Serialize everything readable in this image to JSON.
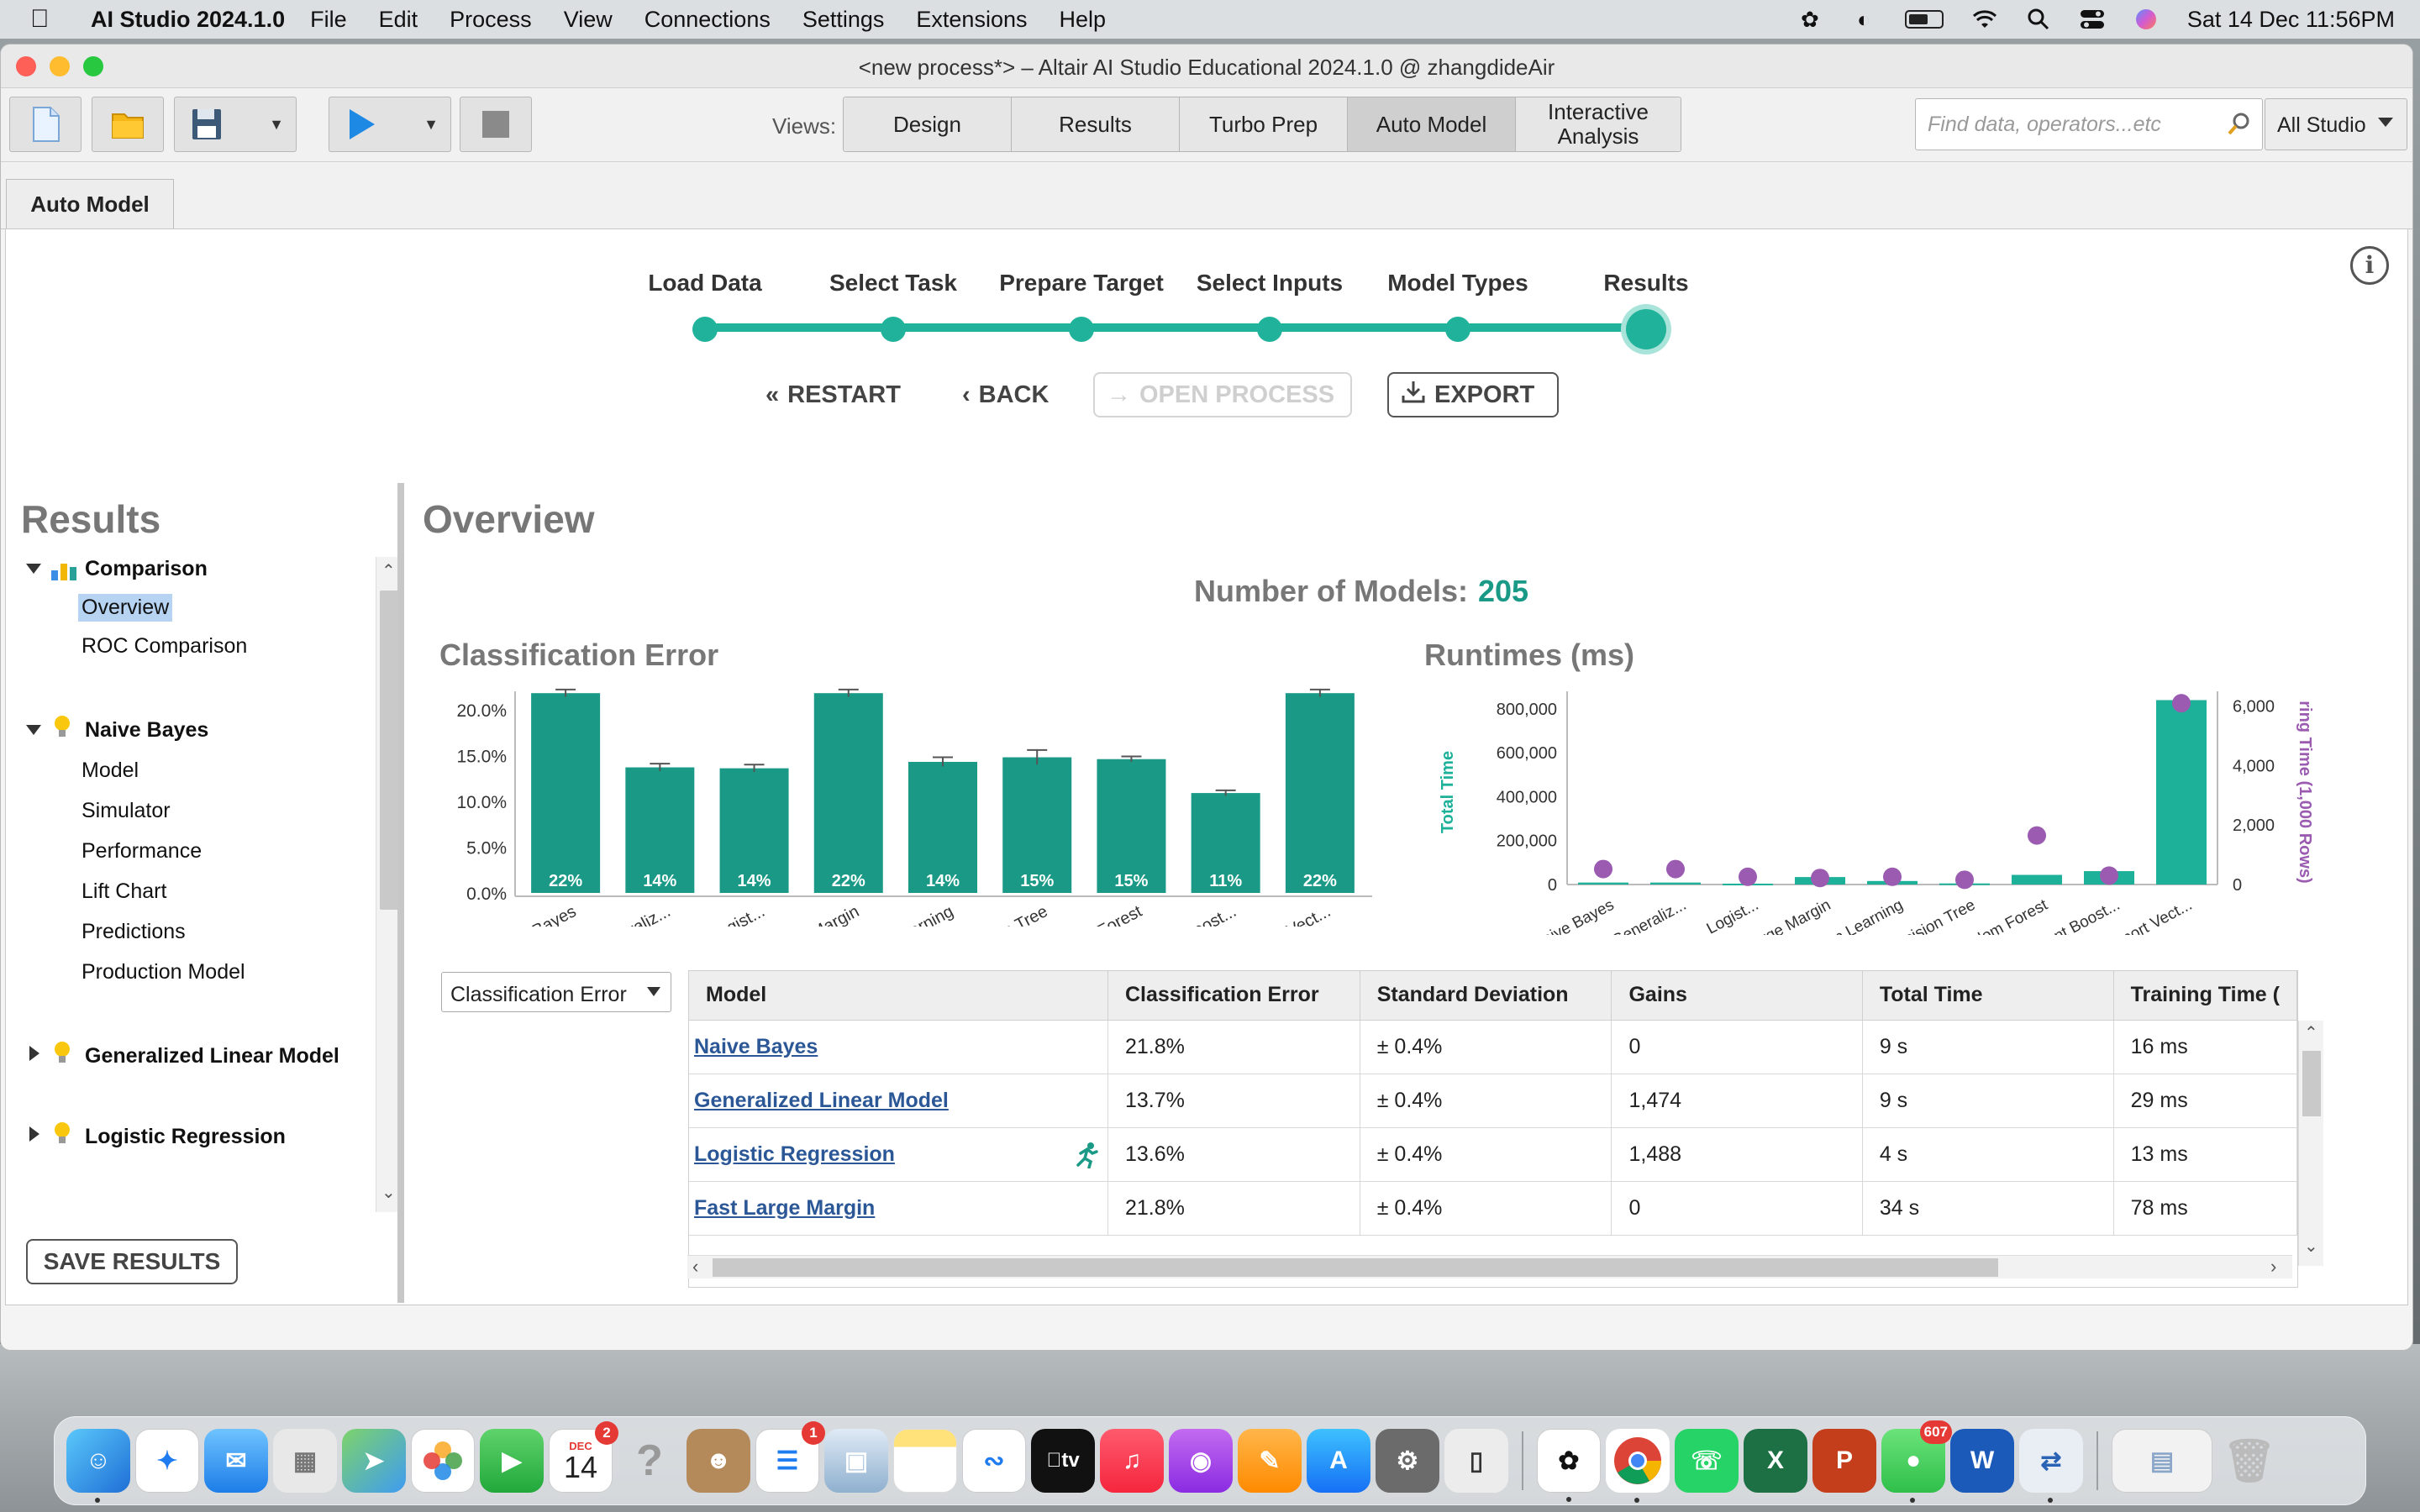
{
  "menubar": {
    "app_name": "AI Studio 2024.1.0",
    "menus": [
      "File",
      "Edit",
      "Process",
      "View",
      "Connections",
      "Settings",
      "Extensions",
      "Help"
    ],
    "datetime": "Sat 14 Dec  11:56PM"
  },
  "window": {
    "title": "<new process*> – Altair AI Studio Educational 2024.1.0 @ zhangdideAir"
  },
  "toolbar": {
    "views_label": "Views:",
    "views": [
      "Design",
      "Results",
      "Turbo Prep",
      "Auto Model",
      "Interactive Analysis"
    ],
    "active_view": "Auto Model",
    "search_placeholder": "Find data, operators...etc",
    "studio_select": "All Studio"
  },
  "tab": {
    "label": "Auto Model"
  },
  "wizard": {
    "steps": [
      "Load Data",
      "Select Task",
      "Prepare Target",
      "Select Inputs",
      "Model Types",
      "Results"
    ],
    "current_step": "Results",
    "restart_label": "RESTART",
    "back_label": "BACK",
    "open_process_label": "OPEN PROCESS",
    "export_label": "EXPORT"
  },
  "results_panel": {
    "title": "Results",
    "tree": [
      {
        "label": "Comparison",
        "group": true,
        "expanded": true,
        "children": [
          "Overview",
          "ROC Comparison"
        ]
      },
      {
        "label": "Naive Bayes",
        "group": true,
        "expanded": true,
        "children": [
          "Model",
          "Simulator",
          "Performance",
          "Lift Chart",
          "Predictions",
          "Production Model"
        ]
      },
      {
        "label": "Generalized Linear Model",
        "group": true,
        "expanded": false,
        "children": []
      },
      {
        "label": "Logistic Regression",
        "group": true,
        "expanded": false,
        "children": []
      }
    ],
    "selected": "Overview",
    "save_label": "SAVE RESULTS"
  },
  "overview": {
    "title": "Overview",
    "num_models_label": "Number of Models:",
    "num_models": "205",
    "error_chart_title": "Classification Error",
    "runtime_chart_title": "Runtimes (ms)"
  },
  "chart_data": [
    {
      "type": "bar",
      "title": "Classification Error",
      "categories": [
        "Naive Bayes",
        "Generaliz...",
        "Logist...",
        "Fast Large Margin",
        "Deep Learning",
        "Decision Tree",
        "Random Forest",
        "Gradient Boost...",
        "Support Vect..."
      ],
      "values": [
        21.8,
        13.7,
        13.6,
        21.8,
        14.3,
        14.8,
        14.6,
        10.9,
        21.8
      ],
      "data_labels": [
        "22%",
        "14%",
        "14%",
        "22%",
        "14%",
        "15%",
        "15%",
        "11%",
        "22%"
      ],
      "error": [
        0.4,
        0.4,
        0.4,
        0.4,
        0.5,
        0.8,
        0.3,
        0.3,
        0.4
      ],
      "ylim": [
        0,
        22
      ],
      "yticks": [
        "0.0%",
        "5.0%",
        "10.0%",
        "15.0%",
        "20.0%"
      ],
      "ytick_values": [
        0,
        5,
        10,
        15,
        20
      ],
      "color": "#1a9a86"
    },
    {
      "type": "bar",
      "title": "Runtimes (ms)",
      "categories": [
        "Naive Bayes",
        "Generaliz...",
        "Logist...",
        "Fast Large Margin",
        "Deep Learning",
        "Decision Tree",
        "Random Forest",
        "Gradient Boost...",
        "Support Vect..."
      ],
      "series": [
        {
          "name": "Total Time",
          "values": [
            9000,
            9000,
            4000,
            34000,
            16000,
            5000,
            44000,
            61000,
            840000
          ],
          "color": "#1db199"
        },
        {
          "name": "ring Time (1,000 Rows)",
          "values": [
            520,
            520,
            260,
            220,
            260,
            160,
            1650,
            300,
            6100
          ],
          "color": "#9a5bb0"
        }
      ],
      "ylabel": "Total Time",
      "y2label": "ring Time (1,000 Rows)",
      "yticks": [
        "0",
        "200,000",
        "400,000",
        "600,000",
        "800,000"
      ],
      "ytick_values": [
        0,
        200000,
        400000,
        600000,
        800000
      ],
      "ylim": [
        0,
        880000
      ],
      "y2ticks": [
        "0",
        "2,000",
        "4,000",
        "6,000"
      ],
      "y2tick_values": [
        0,
        2000,
        4000,
        6000
      ],
      "y2lim": [
        0,
        6500
      ]
    }
  ],
  "table": {
    "metric_select": "Classification Error",
    "columns": [
      "Model",
      "Classification Error",
      "Standard Deviation",
      "Gains",
      "Total Time",
      "Training Time ("
    ],
    "rows": [
      [
        "Naive Bayes",
        "21.8%",
        "± 0.4%",
        "0",
        "9 s",
        "16 ms"
      ],
      [
        "Generalized Linear Model",
        "13.7%",
        "± 0.4%",
        "1,474",
        "9 s",
        "29 ms"
      ],
      [
        "Logistic Regression",
        "13.6%",
        "± 0.4%",
        "1,488",
        "4 s",
        "13 ms"
      ],
      [
        "Fast Large Margin",
        "21.8%",
        "± 0.4%",
        "0",
        "34 s",
        "78 ms"
      ]
    ],
    "best_row_index": 2
  },
  "dock": {
    "apps": [
      "Finder",
      "Safari",
      "Mail",
      "Launchpad",
      "Maps",
      "Photos",
      "FaceTime",
      "Calendar",
      "Help",
      "Contacts",
      "Reminders",
      "Preview",
      "Notes",
      "Freeform",
      "TV",
      "Music",
      "Podcasts",
      "Pages",
      "App Store",
      "System Settings",
      "iPhone Mirroring",
      "ChatGPT",
      "Chrome",
      "WhatsApp",
      "Excel",
      "PowerPoint",
      "Messages",
      "Word",
      "AI Studio",
      "Downloads",
      "Trash"
    ],
    "calendar_month": "DEC",
    "calendar_day": "14",
    "calendar_badge": "2",
    "reminders_badge": "1",
    "messages_badge": "607"
  },
  "colors": {
    "accent": "#1a9a86",
    "link": "#2b5797",
    "purple": "#9a5bb0"
  }
}
